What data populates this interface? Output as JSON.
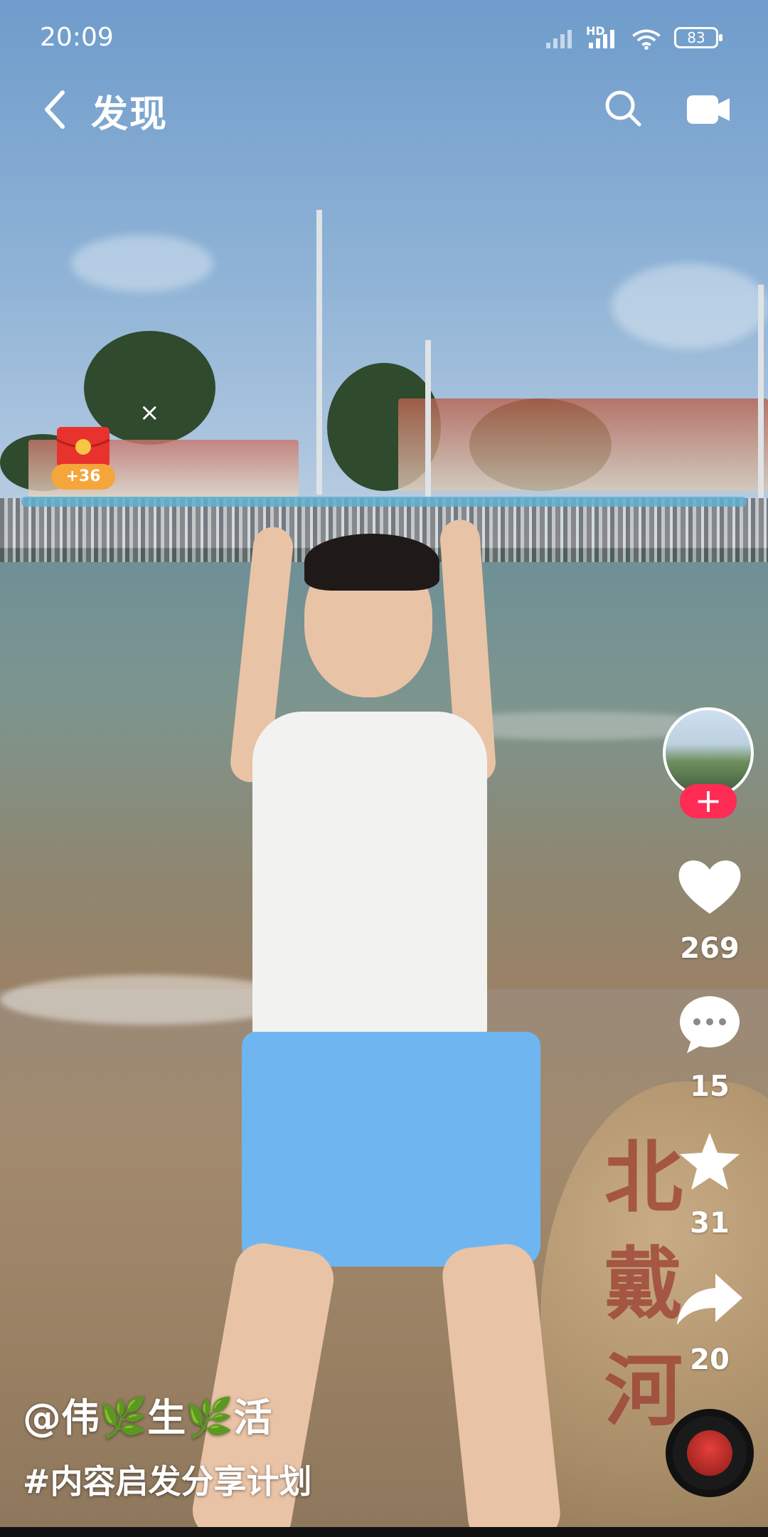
{
  "status_bar": {
    "time": "20:09",
    "network": "HD",
    "battery": "83"
  },
  "top_nav": {
    "title": "发现"
  },
  "red_packet": {
    "amount": "+36",
    "close": "×"
  },
  "actions": {
    "follow": "+",
    "likes": "269",
    "comments": "15",
    "favorites": "31",
    "shares": "20"
  },
  "caption": {
    "author": "@伟🌿生🌿活",
    "hashtag": "#内容启发分享计划"
  },
  "scene_text": {
    "rock_carving": "北戴河"
  },
  "colors": {
    "follow": "#fe2c55",
    "rock_text": "#9b3d2f"
  },
  "icons": [
    "back-arrow-icon",
    "search-icon",
    "camera-icon",
    "red-packet-icon",
    "heart-icon",
    "comment-icon",
    "star-icon",
    "share-icon",
    "music-disc-icon"
  ]
}
